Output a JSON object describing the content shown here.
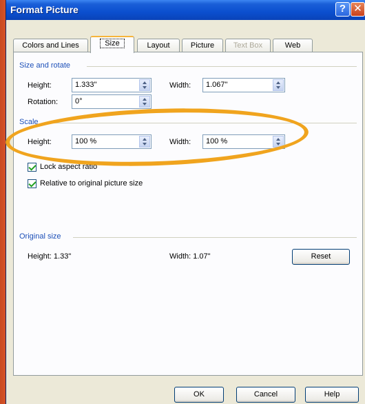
{
  "window": {
    "title": "Format Picture",
    "help_glyph": "?",
    "close_glyph": "✕"
  },
  "tabs": [
    {
      "label": "Colors and Lines",
      "state": "normal"
    },
    {
      "label": "Size",
      "state": "active"
    },
    {
      "label": "Layout",
      "state": "normal"
    },
    {
      "label": "Picture",
      "state": "normal"
    },
    {
      "label": "Text Box",
      "state": "disabled"
    },
    {
      "label": "Web",
      "state": "normal"
    }
  ],
  "size_rotate": {
    "section_title": "Size and rotate",
    "height_label": "Height:",
    "height_value": "1.333\"",
    "width_label": "Width:",
    "width_value": "1.067\"",
    "rotation_label": "Rotation:",
    "rotation_value": "0°"
  },
  "scale": {
    "section_title": "Scale",
    "height_label": "Height:",
    "height_value": "100 %",
    "width_label": "Width:",
    "width_value": "100 %",
    "lock_aspect_label": "Lock aspect ratio",
    "lock_aspect_checked": true,
    "relative_label": "Relative to original picture size",
    "relative_checked": true
  },
  "original_size": {
    "section_title": "Original size",
    "height_text": "Height:  1.33\"",
    "width_text": "Width:  1.07\"",
    "reset_label": "Reset"
  },
  "footer": {
    "ok_label": "OK",
    "cancel_label": "Cancel",
    "help_label": "Help"
  },
  "colors": {
    "title_bar": "#0b4fcf",
    "section_title": "#1c4fb8",
    "highlight_ellipse": "#f0a41e",
    "desktop_bg": "#e0552a"
  }
}
